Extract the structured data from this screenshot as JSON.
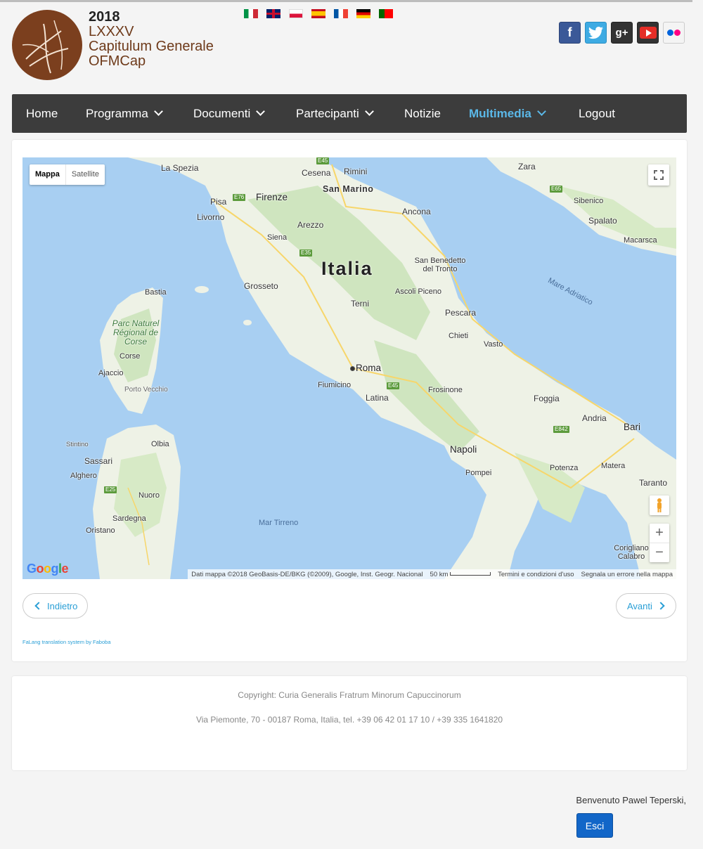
{
  "header": {
    "year": "2018",
    "line1": "LXXXV",
    "line2": "Capitulum Generale",
    "line3": "OFMCap",
    "languages": [
      "it",
      "en",
      "pl",
      "es",
      "fr",
      "de",
      "pt"
    ],
    "social": [
      "facebook-icon",
      "twitter-icon",
      "google-plus-icon",
      "youtube-icon",
      "flickr-icon"
    ]
  },
  "nav": {
    "home": "Home",
    "programma": "Programma",
    "documenti": "Documenti",
    "partecipanti": "Partecipanti",
    "notizie": "Notizie",
    "multimedia": "Multimedia",
    "logout": "Logout",
    "active_color": "#5bb8e8"
  },
  "map": {
    "type_map": "Mappa",
    "type_satellite": "Satellite",
    "google": "Google",
    "attribution": "Dati mappa ©2018 GeoBasis-DE/BKG (©2009), Google, Inst. Geogr. Nacional",
    "scale": "50 km",
    "terms": "Termini e condizioni d'uso",
    "report": "Segnala un errore nella mappa",
    "zoom_in": "+",
    "zoom_out": "−",
    "labels": {
      "italia": "Italia",
      "roma": "Roma",
      "firenze": "Firenze",
      "napoli": "Napoli",
      "bari": "Bari",
      "la_spezia": "La Spezia",
      "cesena": "Cesena",
      "rimini": "Rimini",
      "san_marino": "San Marino",
      "zara": "Zara",
      "pisa": "Pisa",
      "livorno": "Livorno",
      "arezzo": "Arezzo",
      "ancona": "Ancona",
      "sibenico": "Sibenico",
      "spalato": "Spalato",
      "macarsca": "Macarsca",
      "siena": "Siena",
      "san_benedetto": "San Benedetto del Tronto",
      "grosseto": "Grosseto",
      "ascoli": "Ascoli Piceno",
      "bastia": "Bastia",
      "mare_adriatico": "Mare Adriatico",
      "terni": "Terni",
      "pescara": "Pescara",
      "parc": "Parc Naturel Régional de Corse",
      "chieti": "Chieti",
      "corse": "Corse",
      "vasto": "Vasto",
      "ajaccio": "Ajaccio",
      "porto_vecchio": "Porto Vecchio",
      "fiumicino": "Fiumicino",
      "frosinone": "Frosinone",
      "latina": "Latina",
      "foggia": "Foggia",
      "andria": "Andria",
      "stintino": "Stintino",
      "olbia": "Olbia",
      "sassari": "Sassari",
      "alghero": "Alghero",
      "nuoro": "Nuoro",
      "potenza": "Potenza",
      "matera": "Matera",
      "pompei": "Pompei",
      "taranto": "Taranto",
      "sardegna": "Sardegna",
      "mar_tirreno": "Mar Tirreno",
      "oristano": "Oristano",
      "corigliano": "Corigliano Calabro",
      "e45": "E45",
      "e76": "E76",
      "e35": "E35",
      "e65": "E65",
      "e842": "E842",
      "e25": "E25"
    }
  },
  "pagination": {
    "back": "Indietro",
    "next": "Avanti"
  },
  "falang": "FaLang translation system by Faboba",
  "footer": {
    "copyright": "Copyright: Curia Generalis Fratrum Minorum Capuccinorum",
    "address": "Via Piemonte, 70 - 00187 Roma, Italia, tel. +39 06 42 01 17 10 / +39 335 1641820"
  },
  "user": {
    "welcome": "Benvenuto Pawel Teperski,",
    "logout_button": "Esci"
  }
}
